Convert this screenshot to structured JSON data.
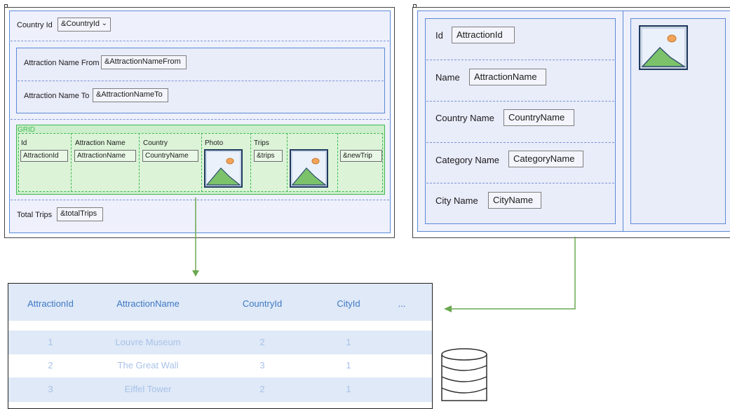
{
  "left_form": {
    "country_label": "Country Id",
    "country_field": "&CountryId",
    "name_from_label": "Attraction Name From",
    "name_from_field": "&AttractionNameFrom",
    "name_to_label": "Attraction Name To",
    "name_to_field": "&AttractionNameTo",
    "grid_title": "GRID",
    "grid_headers": [
      "Id",
      "Attraction Name",
      "Country",
      "Photo",
      "Trips"
    ],
    "grid_fields": [
      "AttractionId",
      "AttractionName",
      "CountryName",
      "&trips",
      "&newTrip"
    ],
    "total_label": "Total Trips",
    "total_field": "&totalTrips"
  },
  "right_form": {
    "id_label": "Id",
    "id_field": "AttractionId",
    "name_label": "Name",
    "name_field": "AttractionName",
    "country_label": "Country Name",
    "country_field": "CountryName",
    "category_label": "Category Name",
    "category_field": "CategoryName",
    "city_label": "City Name",
    "city_field": "CityName"
  },
  "table": {
    "headers": [
      "AttractionId",
      "AttractionName",
      "CountryId",
      "CityId",
      "..."
    ],
    "rows": [
      [
        "1",
        "Louvre Museum",
        "2",
        "1"
      ],
      [
        "2",
        "The Great Wall",
        "3",
        "1"
      ],
      [
        "3",
        "Eiffel Tower",
        "2",
        "1"
      ]
    ]
  },
  "icons": [
    "image-icon",
    "database-icon",
    "arrow-icon"
  ],
  "colors": {
    "form_border": "#5b8bd6",
    "form_fill": "#e9ecf9",
    "grid_green": "#3dba4f",
    "table_header": "#3f78c4",
    "arrow_green": "#6aa84f"
  }
}
